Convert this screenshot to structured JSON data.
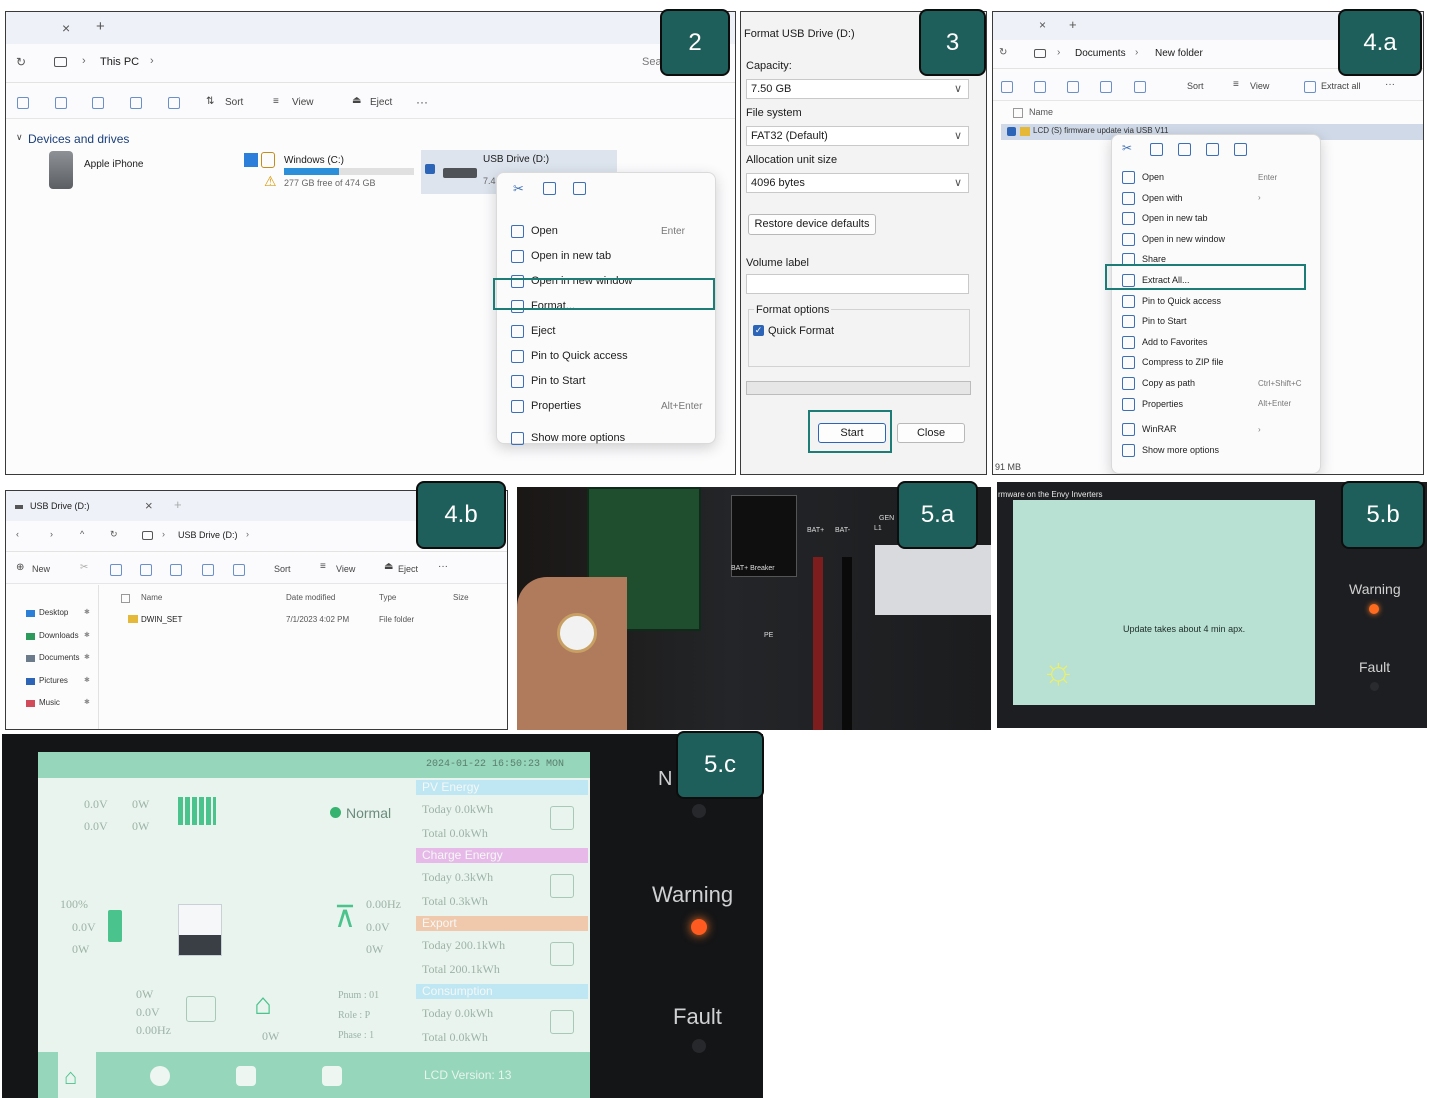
{
  "steps": [
    "2",
    "3",
    "4.a",
    "4.b",
    "5.a",
    "5.b",
    "5.c"
  ],
  "panel2": {
    "tab_close": "×",
    "tab_add": "+",
    "path": [
      "This PC"
    ],
    "search": "Sea",
    "toolbar": {
      "sort": "Sort",
      "view": "View",
      "eject": "Eject",
      "more": "···"
    },
    "section": "Devices and drives",
    "drives": [
      {
        "name": "Apple iPhone"
      },
      {
        "name": "Windows (C:)",
        "free": "277 GB free of 474 GB",
        "used_fraction": 0.42
      },
      {
        "name": "USB Drive (D:)",
        "free": "7.4"
      }
    ],
    "context_menu": [
      {
        "label": "Open",
        "shortcut": "Enter"
      },
      {
        "label": "Open in new tab",
        "shortcut": ""
      },
      {
        "label": "Open in new window",
        "shortcut": ""
      },
      {
        "label": "Format...",
        "shortcut": ""
      },
      {
        "label": "Eject",
        "shortcut": ""
      },
      {
        "label": "Pin to Quick access",
        "shortcut": ""
      },
      {
        "label": "Pin to Start",
        "shortcut": ""
      },
      {
        "label": "Properties",
        "shortcut": "Alt+Enter"
      },
      {
        "label": "Show more options",
        "shortcut": ""
      }
    ]
  },
  "panel3": {
    "title": "Format USB Drive (D:)",
    "capacity_label": "Capacity:",
    "capacity_value": "7.50 GB",
    "fs_label": "File system",
    "fs_value": "FAT32 (Default)",
    "alloc_label": "Allocation unit size",
    "alloc_value": "4096 bytes",
    "restore": "Restore device defaults",
    "volume_label": "Volume label",
    "format_options": "Format options",
    "quick_format": "Quick Format",
    "start": "Start",
    "close": "Close"
  },
  "panel4a": {
    "tab_close": "×",
    "tab_add": "+",
    "path": [
      "Documents",
      "New folder"
    ],
    "toolbar": {
      "sort": "Sort",
      "view": "View",
      "extract": "Extract all",
      "more": "···"
    },
    "header_name": "Name",
    "row": "LCD (S) firmware update via USB V11",
    "status": "91 MB",
    "context_menu": [
      {
        "label": "Open",
        "shortcut": "Enter"
      },
      {
        "label": "Open with",
        "shortcut": "›"
      },
      {
        "label": "Open in new tab",
        "shortcut": ""
      },
      {
        "label": "Open in new window",
        "shortcut": ""
      },
      {
        "label": "Share",
        "shortcut": ""
      },
      {
        "label": "Extract All...",
        "shortcut": ""
      },
      {
        "label": "Pin to Quick access",
        "shortcut": ""
      },
      {
        "label": "Pin to Start",
        "shortcut": ""
      },
      {
        "label": "Add to Favorites",
        "shortcut": ""
      },
      {
        "label": "Compress to ZIP file",
        "shortcut": ""
      },
      {
        "label": "Copy as path",
        "shortcut": "Ctrl+Shift+C"
      },
      {
        "label": "Properties",
        "shortcut": "Alt+Enter"
      },
      {
        "label": "WinRAR",
        "shortcut": "›"
      },
      {
        "label": "Show more options",
        "shortcut": ""
      }
    ]
  },
  "panel4b": {
    "tab_title": "USB Drive (D:)",
    "tab_close": "×",
    "tab_add": "+",
    "path": [
      "USB Drive (D:)"
    ],
    "toolbar": {
      "new": "New",
      "sort": "Sort",
      "view": "View",
      "eject": "Eject",
      "more": "···"
    },
    "columns": [
      "Name",
      "Date modified",
      "Type",
      "Size"
    ],
    "sidebar": [
      "Desktop",
      "Downloads",
      "Documents",
      "Pictures",
      "Music"
    ],
    "rows": [
      {
        "name": "DWIN_SET",
        "date": "7/1/2023 4:02 PM",
        "type": "File folder",
        "size": ""
      }
    ]
  },
  "panel5a": {
    "labels": {
      "bat_pos": "BAT+",
      "bat_neg": "BAT-",
      "breaker": "BAT+ Breaker",
      "gen": "GEN",
      "l1": "L1",
      "pe": "PE"
    }
  },
  "panel5b": {
    "caption": "rmware on the Envy Inverters",
    "message": "Update takes about 4 min apx.",
    "warning": "Warning",
    "fault": "Fault"
  },
  "panel5c": {
    "datetime": "2024-01-22 16:50:23 MON",
    "pv_row1": [
      "0.0V",
      "0W"
    ],
    "pv_row2": [
      "0.0V",
      "0W"
    ],
    "status": "Normal",
    "battery": [
      "100%",
      "0.0V",
      "0W"
    ],
    "grid": [
      "0.00Hz",
      "0.0V",
      "0W"
    ],
    "load": [
      "0W",
      "0.0V",
      "0.00Hz"
    ],
    "load_power": "0W",
    "info": [
      "Pnum :  01",
      "Role :  P",
      "Phase :  1"
    ],
    "sections": [
      {
        "title": "PV Energy",
        "today": "Today  0.0kWh",
        "total": "Total  0.0kWh",
        "color": "#bfe6f3"
      },
      {
        "title": "Charge Energy",
        "today": "Today  0.3kWh",
        "total": "Total  0.3kWh",
        "color": "#e6b9e8"
      },
      {
        "title": "Export",
        "today": "Today  200.1kWh",
        "total": "Total  200.1kWh",
        "color": "#f0c9ad"
      },
      {
        "title": "Consumption",
        "today": "Today  0.0kWh",
        "total": "Total  0.0kWh",
        "color": "#bfe6f3"
      }
    ],
    "lcd_version": "LCD Version:  13",
    "side_n": "N",
    "warning": "Warning",
    "fault": "Fault"
  }
}
